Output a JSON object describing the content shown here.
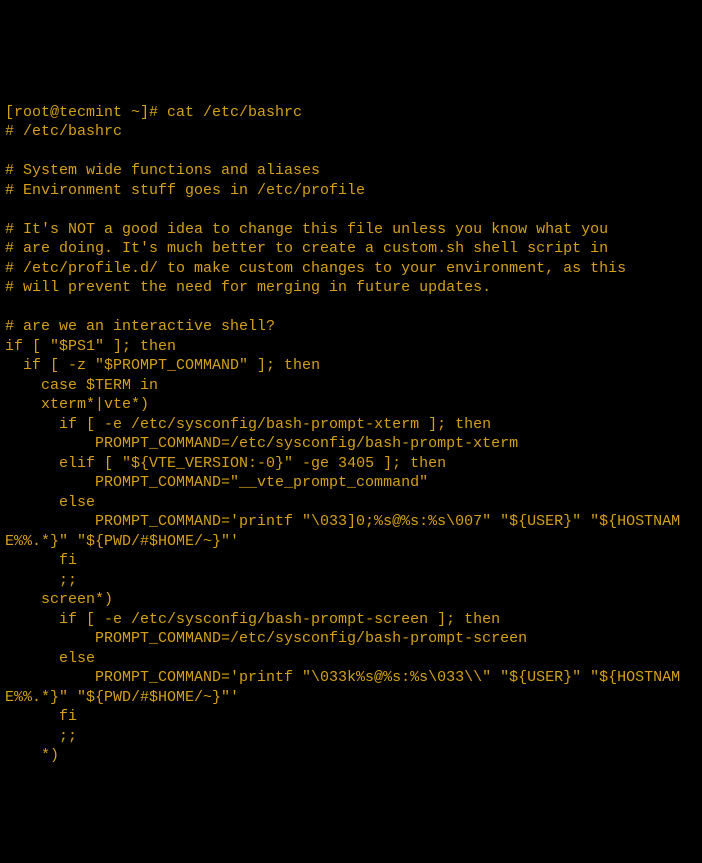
{
  "terminal": {
    "prompt": "[root@tecmint ~]# ",
    "command": "cat /etc/bashrc",
    "lines": [
      "# /etc/bashrc",
      "",
      "# System wide functions and aliases",
      "# Environment stuff goes in /etc/profile",
      "",
      "# It's NOT a good idea to change this file unless you know what you",
      "# are doing. It's much better to create a custom.sh shell script in",
      "# /etc/profile.d/ to make custom changes to your environment, as this",
      "# will prevent the need for merging in future updates.",
      "",
      "# are we an interactive shell?",
      "if [ \"$PS1\" ]; then",
      "  if [ -z \"$PROMPT_COMMAND\" ]; then",
      "    case $TERM in",
      "    xterm*|vte*)",
      "      if [ -e /etc/sysconfig/bash-prompt-xterm ]; then",
      "          PROMPT_COMMAND=/etc/sysconfig/bash-prompt-xterm",
      "      elif [ \"${VTE_VERSION:-0}\" -ge 3405 ]; then",
      "          PROMPT_COMMAND=\"__vte_prompt_command\"",
      "      else",
      "          PROMPT_COMMAND='printf \"\\033]0;%s@%s:%s\\007\" \"${USER}\" \"${HOSTNAME%%.*}\" \"${PWD/#$HOME/~}\"'",
      "      fi",
      "      ;;",
      "    screen*)",
      "      if [ -e /etc/sysconfig/bash-prompt-screen ]; then",
      "          PROMPT_COMMAND=/etc/sysconfig/bash-prompt-screen",
      "      else",
      "          PROMPT_COMMAND='printf \"\\033k%s@%s:%s\\033\\\\\" \"${USER}\" \"${HOSTNAME%%.*}\" \"${PWD/#$HOME/~}\"'",
      "      fi",
      "      ;;",
      "    *)"
    ]
  }
}
